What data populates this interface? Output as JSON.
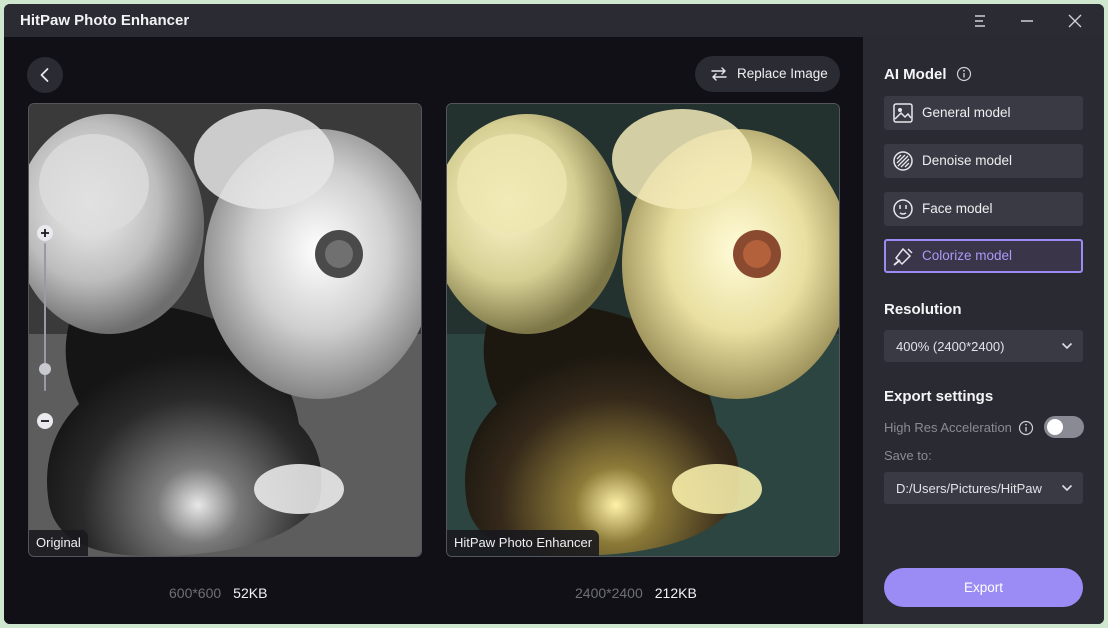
{
  "app": {
    "title": "HitPaw Photo Enhancer"
  },
  "toolbar": {
    "replace_label": "Replace Image"
  },
  "compare": {
    "original": {
      "label": "Original",
      "dimensions": "600*600",
      "size": "52KB"
    },
    "enhanced": {
      "label": "HitPaw Photo Enhancer",
      "dimensions": "2400*2400",
      "size": "212KB"
    },
    "zoom_level": 0.15
  },
  "sidebar": {
    "ai_model_title": "AI Model",
    "models": [
      {
        "label": "General model",
        "icon": "image-icon",
        "active": false
      },
      {
        "label": "Denoise model",
        "icon": "denoise-icon",
        "active": false
      },
      {
        "label": "Face model",
        "icon": "face-icon",
        "active": false
      },
      {
        "label": "Colorize model",
        "icon": "paint-bucket-icon",
        "active": true
      }
    ],
    "resolution_title": "Resolution",
    "resolution_value": "400% (2400*2400)",
    "export_title": "Export settings",
    "high_res_label": "High Res Acceleration",
    "high_res_enabled": false,
    "save_to_label": "Save to:",
    "save_path": "D:/Users/Pictures/HitPaw",
    "export_label": "Export"
  },
  "colors": {
    "accent": "#9b8cf5",
    "background": "#101016",
    "panel": "#2a2a32"
  }
}
